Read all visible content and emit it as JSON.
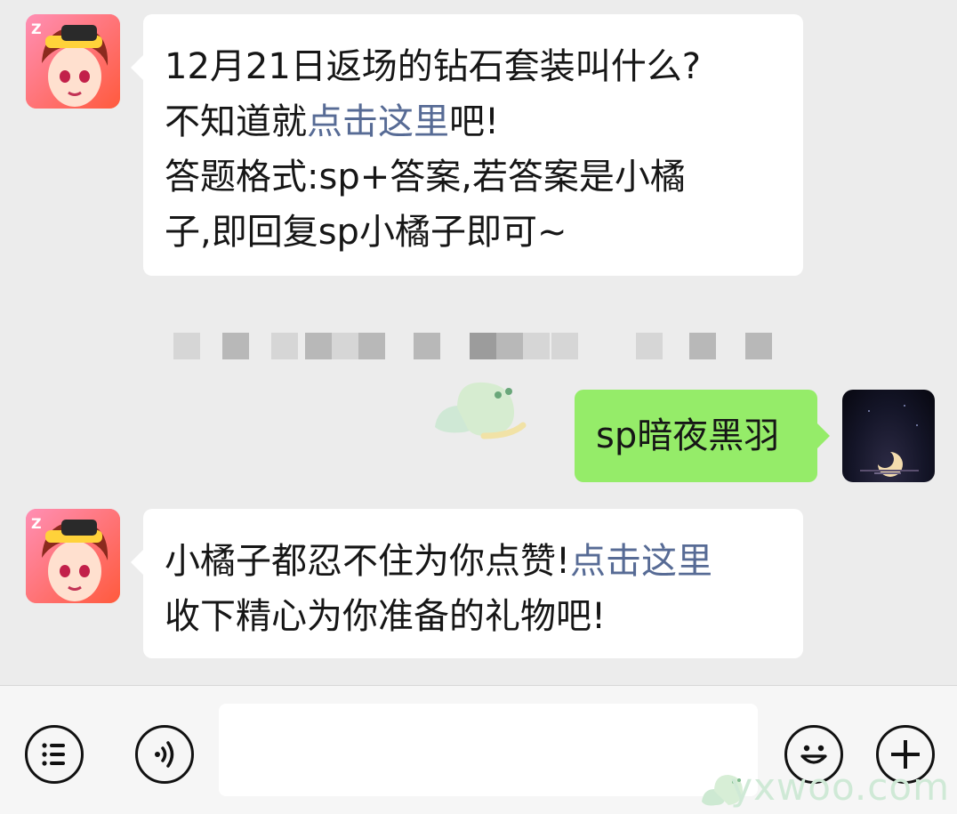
{
  "messages": [
    {
      "sender": "official-account",
      "lines": [
        {
          "text": "12月21日返场的钻石套装叫什么?"
        },
        {
          "before": "不知道就",
          "link": "点击这里",
          "after": "吧!"
        },
        {
          "text": "答题格式:sp+答案,若答案是小橘"
        },
        {
          "text": "子,即回复sp小橘子即可~"
        }
      ]
    },
    {
      "sender": "me",
      "text": "sp暗夜黑羽"
    },
    {
      "sender": "official-account",
      "lines": [
        {
          "before": "小橘子都忍不住为你点赞!",
          "link": "点击这里"
        },
        {
          "text": "收下精心为你准备的礼物吧!"
        }
      ]
    }
  ],
  "colors": {
    "background": "#ececec",
    "bubble_received": "#ffffff",
    "bubble_sent": "#95ec69",
    "link": "#576b95"
  },
  "input_bar": {
    "left_icons": [
      "menu-list-icon",
      "voice-icon"
    ],
    "right_icons": [
      "emoji-icon",
      "plus-icon"
    ]
  },
  "watermark": "yxwoo.com"
}
